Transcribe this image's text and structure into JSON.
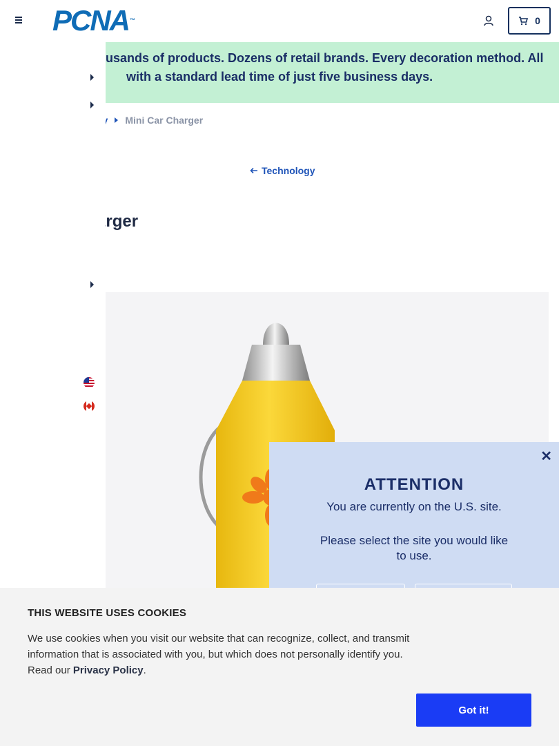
{
  "header": {
    "logo_text": "PCNA",
    "logo_tm": "™",
    "cart_count": "0"
  },
  "banner": {
    "line1": "usands of products. Dozens of retail brands. Every decoration method. All",
    "line2": "with a standard lead time of just five business days."
  },
  "breadcrumb": {
    "parent_label": "gy",
    "current_label": "Mini Car Charger"
  },
  "back_link": {
    "label": "Technology"
  },
  "product": {
    "title": "arger",
    "body_color": "#f7cf1f",
    "logo_color": "#f07a1a"
  },
  "attention_modal": {
    "close_label": "✕",
    "heading": "ATTENTION",
    "message": "You are currently on the U.S. site.",
    "prompt": "Please select the site you would like to use."
  },
  "cookie_banner": {
    "heading": "THIS WEBSITE USES COOKIES",
    "text_before_link": "We use cookies when you visit our website that can recognize, collect, and transmit information that is associated with you, but which does not personally identify you. Read our ",
    "link_label": "Privacy Policy",
    "text_after_link": ".",
    "button_label": "Got it!"
  },
  "colors": {
    "brand_blue": "#0f6cb6",
    "banner_green": "#c3f0d4",
    "link_blue": "#1f54b8",
    "modal_bg": "#cfdcf3",
    "cookie_button": "#1a3cf5"
  }
}
